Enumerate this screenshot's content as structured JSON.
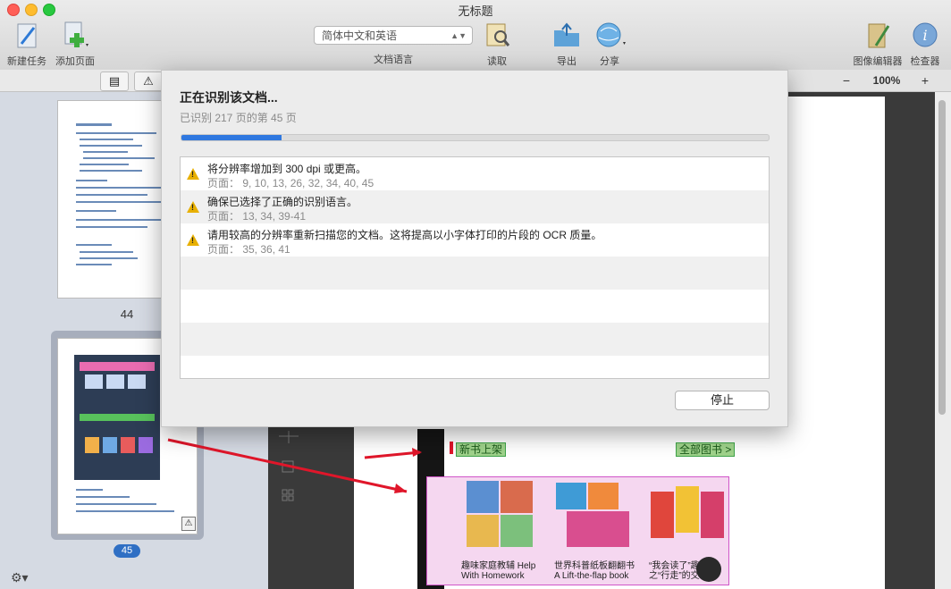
{
  "window": {
    "title": "无标题"
  },
  "toolbar": {
    "new_task": "新建任务",
    "add_page": "添加页面",
    "language_value": "简体中文和英语",
    "language_caption": "文档语言",
    "read": "读取",
    "export": "导出",
    "share": "分享",
    "image_editor": "图像编辑器",
    "inspector": "检查器"
  },
  "sidebar": {
    "pages": [
      {
        "number": "44"
      },
      {
        "number": "45",
        "selected": true
      }
    ]
  },
  "zoom": {
    "value": "100%",
    "minus": "−",
    "plus": "+"
  },
  "dialog": {
    "title": "正在识别该文档...",
    "subtitle": "已识别 217 页的第 45 页",
    "progress_fraction": 0.17,
    "warnings": [
      {
        "message": "将分辨率增加到 300 dpi 或更高。",
        "pages": "页面：  9, 10, 13, 26, 32, 34, 40, 45"
      },
      {
        "message": "确保已选择了正确的识别语言。",
        "pages": "页面：  13, 34, 39-41"
      },
      {
        "message": "请用较高的分辨率重新扫描您的文档。这将提高以小字体打印的片段的 OCR 质量。",
        "pages": "页面：  35, 36, 41"
      }
    ],
    "stop_button": "停止"
  },
  "document": {
    "new_books_label": "新书上架",
    "all_books_label": "全部图书 >",
    "books": [
      {
        "title_cn": "趣味家庭教辅 Help",
        "title_en": "With Homework"
      },
      {
        "title_cn": "世界科普纸板翻翻书",
        "title_en": "A Lift-the-flap book"
      },
      {
        "title_cn": "“我会读了”趣",
        "title_en": "之“行走”的交"
      }
    ]
  },
  "colors": {
    "accent": "#2f78e0",
    "warning": "#e8b000",
    "highlight_green": "#9fd38b",
    "highlight_pink": "#f5d7f0",
    "arrow_red": "#e0162a"
  }
}
